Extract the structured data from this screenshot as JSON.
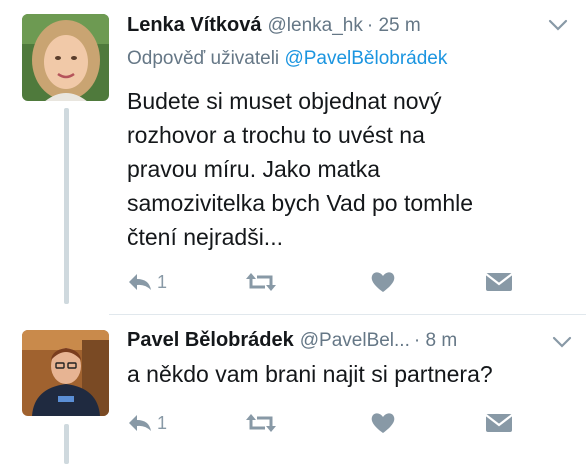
{
  "tweets": [
    {
      "name": "Lenka Vítková",
      "handle": "@lenka_hk",
      "time": "· 25 m",
      "reply_prefix": "Odpověď uživateli",
      "reply_mention": "@PavelBělobrádek",
      "text": "Budete si muset objednat nový\nrozhovor a trochu to uvést na\npravou míru. Jako matka\nsamozivitelka bych Vad po tomhle\nčtení nejradši...",
      "reply_count": "1",
      "avatar_icon": "woman-photo-avatar"
    },
    {
      "name": "Pavel Bělobrádek",
      "handle": "@PavelBel...",
      "time": "· 8 m",
      "text": "a někdo vam brani najit si partnera?",
      "reply_count": "1",
      "avatar_icon": "man-photo-avatar"
    }
  ],
  "colors": {
    "name": "#14171a",
    "meta": "#657786",
    "mention": "#1b95e0",
    "action": "#8899a6",
    "thread_line": "#cfd9de"
  },
  "icons": [
    "reply-icon",
    "retweet-icon",
    "like-heart-icon",
    "direct-message-icon",
    "chevron-down-icon"
  ]
}
